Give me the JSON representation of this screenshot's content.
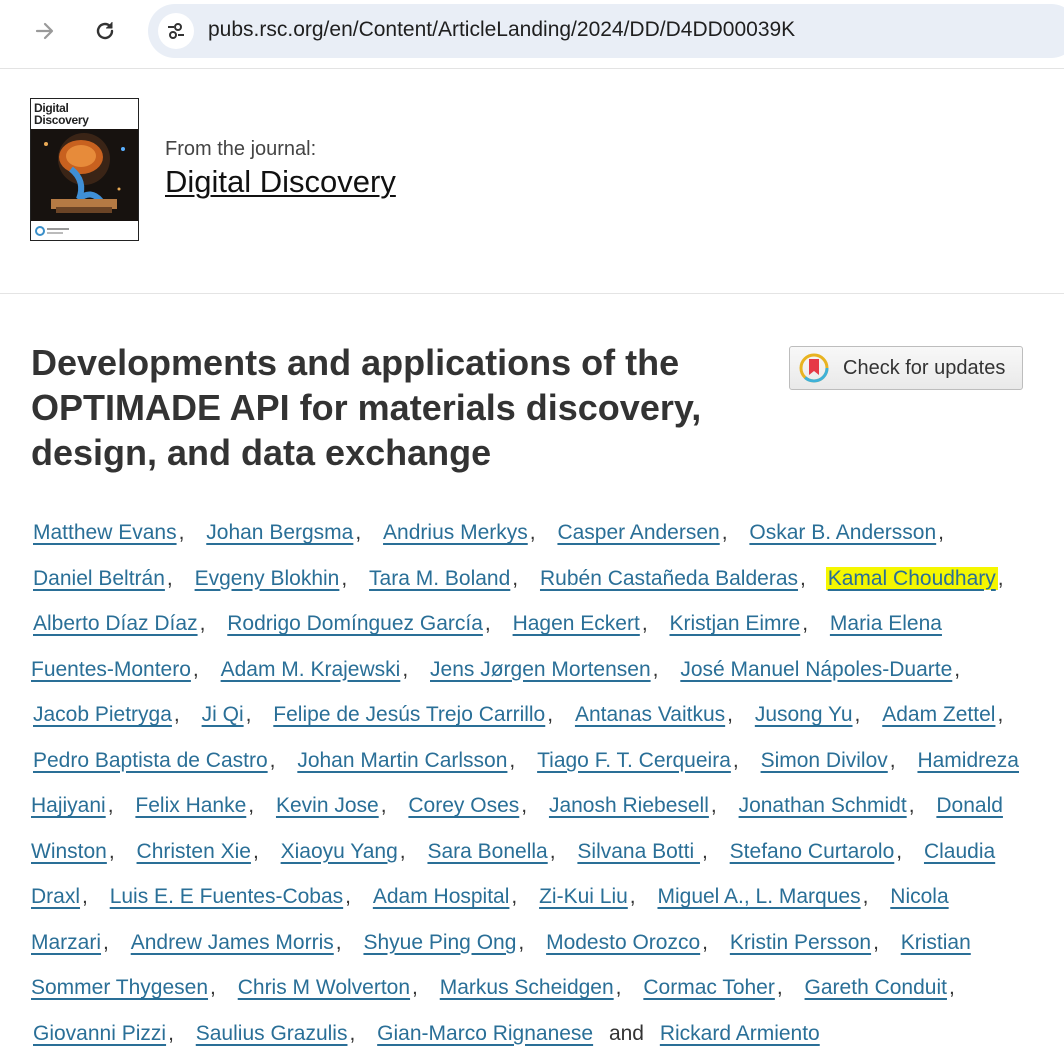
{
  "browser": {
    "url": "pubs.rsc.org/en/Content/ArticleLanding/2024/DD/D4DD00039K"
  },
  "journal": {
    "cover_title_line1": "Digital",
    "cover_title_line2": "Discovery",
    "from_label": "From the journal:",
    "name": "Digital Discovery"
  },
  "article": {
    "title": "Developments and applications of the OPTIMADE API for materials discovery, design, and data exchange",
    "check_updates_label": "Check for updates"
  },
  "authors": {
    "conjunction": "and",
    "highlight_color": "#f5f700",
    "link_color": "#2a6f97",
    "list": [
      "Matthew Evans",
      "Johan Bergsma",
      "Andrius Merkys",
      "Casper Andersen",
      "Oskar B. Andersson",
      "Daniel Beltrán",
      "Evgeny Blokhin",
      "Tara M. Boland",
      "Rubén Castañeda Balderas",
      "Kamal Choudhary",
      "Alberto Díaz Díaz",
      "Rodrigo Domínguez García",
      "Hagen Eckert",
      "Kristjan Eimre",
      "Maria Elena Fuentes-Montero",
      "Adam M. Krajewski",
      "Jens Jørgen Mortensen",
      "José Manuel Nápoles-Duarte",
      "Jacob Pietryga",
      "Ji Qi",
      "Felipe de Jesús Trejo Carrillo",
      "Antanas Vaitkus",
      "Jusong Yu",
      "Adam Zettel",
      "Pedro Baptista de Castro",
      "Johan Martin Carlsson",
      "Tiago F. T. Cerqueira",
      "Simon Divilov",
      "Hamidreza Hajiyani",
      "Felix Hanke",
      "Kevin Jose",
      "Corey Oses",
      "Janosh Riebesell",
      "Jonathan Schmidt",
      "Donald Winston",
      "Christen Xie",
      "Xiaoyu Yang",
      "Sara Bonella",
      "Silvana Botti ",
      "Stefano Curtarolo",
      "Claudia Draxl",
      "Luis E. E Fuentes-Cobas",
      "Adam Hospital",
      "Zi-Kui Liu",
      "Miguel A., L. Marques",
      "Nicola Marzari",
      "Andrew James Morris",
      "Shyue Ping Ong",
      "Modesto Orozco",
      "Kristin Persson",
      "Kristian Sommer Thygesen",
      "Chris M Wolverton",
      "Markus Scheidgen",
      "Cormac Toher",
      "Gareth Conduit",
      "Giovanni Pizzi",
      "Saulius Grazulis",
      "Gian-Marco Rignanese",
      "Rickard Armiento"
    ],
    "highlighted": "Kamal Choudhary"
  }
}
